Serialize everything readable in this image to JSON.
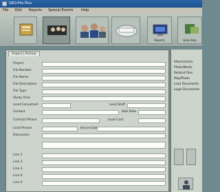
{
  "window": {
    "title": "GEO-File Plus"
  },
  "menu": [
    "File",
    "Edit",
    "Reports",
    "Special Events",
    "Help"
  ],
  "toolbar": {
    "buttons": [
      {
        "id": "contacts",
        "label": ""
      },
      {
        "id": "clients",
        "label": ""
      },
      {
        "id": "staff",
        "label": ""
      },
      {
        "id": "notes",
        "label": ""
      },
      {
        "id": "reports",
        "label": "Reports"
      },
      {
        "id": "help",
        "label": "Help Help"
      }
    ]
  },
  "form": {
    "tab": "Project | Partner",
    "labels": {
      "project": "Project",
      "file_number": "File Number",
      "file_name": "File Name",
      "file_description": "File Description",
      "file_type": "File Type",
      "study_area": "Study Area",
      "lead_consultant": "Lead Consultant",
      "contact": "Contact",
      "contract_phase": "Contract Phase",
      "lead_staff": "Lead Staff",
      "stat_date": "Stat Date",
      "lead_cost": "Lead Cost",
      "lead_person": "Lead Person",
      "record_date": "Record Date",
      "discussion": "Discussion",
      "line1": "Line 1",
      "line2": "Line 2",
      "line3": "Line 3",
      "line4": "Line 4",
      "line5": "Line 5"
    },
    "values": {
      "project": "",
      "file_number": "",
      "file_name": "",
      "file_description": "",
      "file_type": "",
      "study_area": "",
      "lead_consultant": "",
      "contact": "",
      "contract_phase": "",
      "lead_staff": "",
      "stat_date": "",
      "lead_cost": "",
      "lead_person": "",
      "record_date": "",
      "discussion": ""
    }
  },
  "sidebar": {
    "items": [
      "Attachments",
      "Photo/Media",
      "Related Files",
      "Map/Photo",
      "Lead Documents",
      "Legal Documents"
    ]
  }
}
